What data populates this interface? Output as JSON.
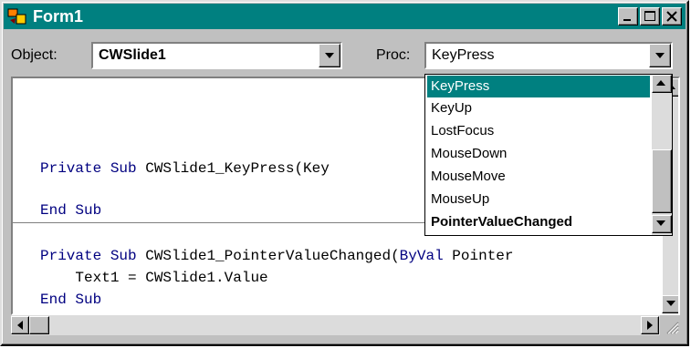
{
  "window": {
    "title": "Form1"
  },
  "object": {
    "label": "Object:",
    "value": "CWSlide1"
  },
  "proc": {
    "label": "Proc:",
    "value": "KeyPress"
  },
  "proc_list": {
    "items": [
      "KeyPress",
      "KeyUp",
      "LostFocus",
      "MouseDown",
      "MouseMove",
      "MouseUp",
      "PointerValueChanged"
    ],
    "selected": "KeyPress",
    "bold": "PointerValueChanged"
  },
  "code": {
    "keyword_private_sub": "Private Sub",
    "keyword_end_sub": "End Sub",
    "keyword_byval": "ByVal",
    "line1_rest": " CWSlide1_KeyPress(Key",
    "line3_rest": " CWSlide1_PointerValueChanged(",
    "line3_tail": " Pointer",
    "line4": "    Text1 = CWSlide1.Value"
  },
  "colors": {
    "titlebar": "#008080",
    "selection": "#008080",
    "keyword": "#000080"
  }
}
